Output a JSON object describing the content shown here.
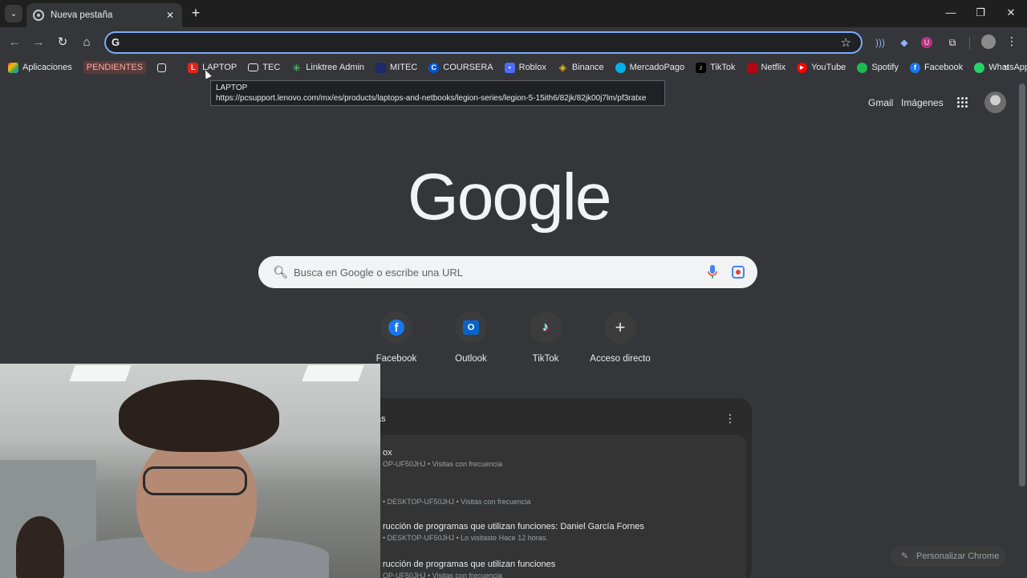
{
  "tab": {
    "title": "Nueva pestaña",
    "close": "✕"
  },
  "toolbar": {
    "new_tab": "+"
  },
  "window": {
    "minimize": "—",
    "restore": "❐",
    "close": "✕"
  },
  "bookmarks": {
    "apps": "Aplicaciones",
    "pendientes": "PENDIENTES",
    "items": [
      "LAPTOP",
      "TEC",
      "Linktree Admin",
      "MITEC",
      "COURSERA",
      "Roblox",
      "Binance",
      "MercadoPago",
      "TikTok",
      "Netflix",
      "YouTube",
      "Spotify",
      "Facebook",
      "WhatsApp"
    ]
  },
  "tooltip": {
    "title": "LAPTOP",
    "url": "https://pcsupport.lenovo.com/mx/es/products/laptops-and-netbooks/legion-series/legion-5-15ith6/82jk/82jk00j7lm/pf3ratxe"
  },
  "ntp": {
    "gmail": "Gmail",
    "images": "Imágenes",
    "logo": "Google",
    "search_placeholder": "Busca en Google o escribe una URL"
  },
  "shortcuts": [
    {
      "label": "Facebook"
    },
    {
      "label": "Outlook"
    },
    {
      "label": "TikTok"
    },
    {
      "label": "Acceso directo"
    }
  ],
  "history": {
    "title": "as",
    "items": [
      {
        "title": "ox",
        "sub": "OP-UF50JHJ • Visitas con frecuencia"
      },
      {
        "title": "",
        "sub": "• DESKTOP-UF50JHJ • Visitas con frecuencia"
      },
      {
        "title": "rucción de programas que utilizan funciones: Daniel García Fornes",
        "sub": "• DESKTOP-UF50JHJ • Lo visitaste Hace 12 horas."
      },
      {
        "title": "rucción de programas que utilizan funciones",
        "sub": "OP-UF50JHJ • Visitas con frecuencia"
      }
    ]
  },
  "customize": "Personalizar Chrome"
}
